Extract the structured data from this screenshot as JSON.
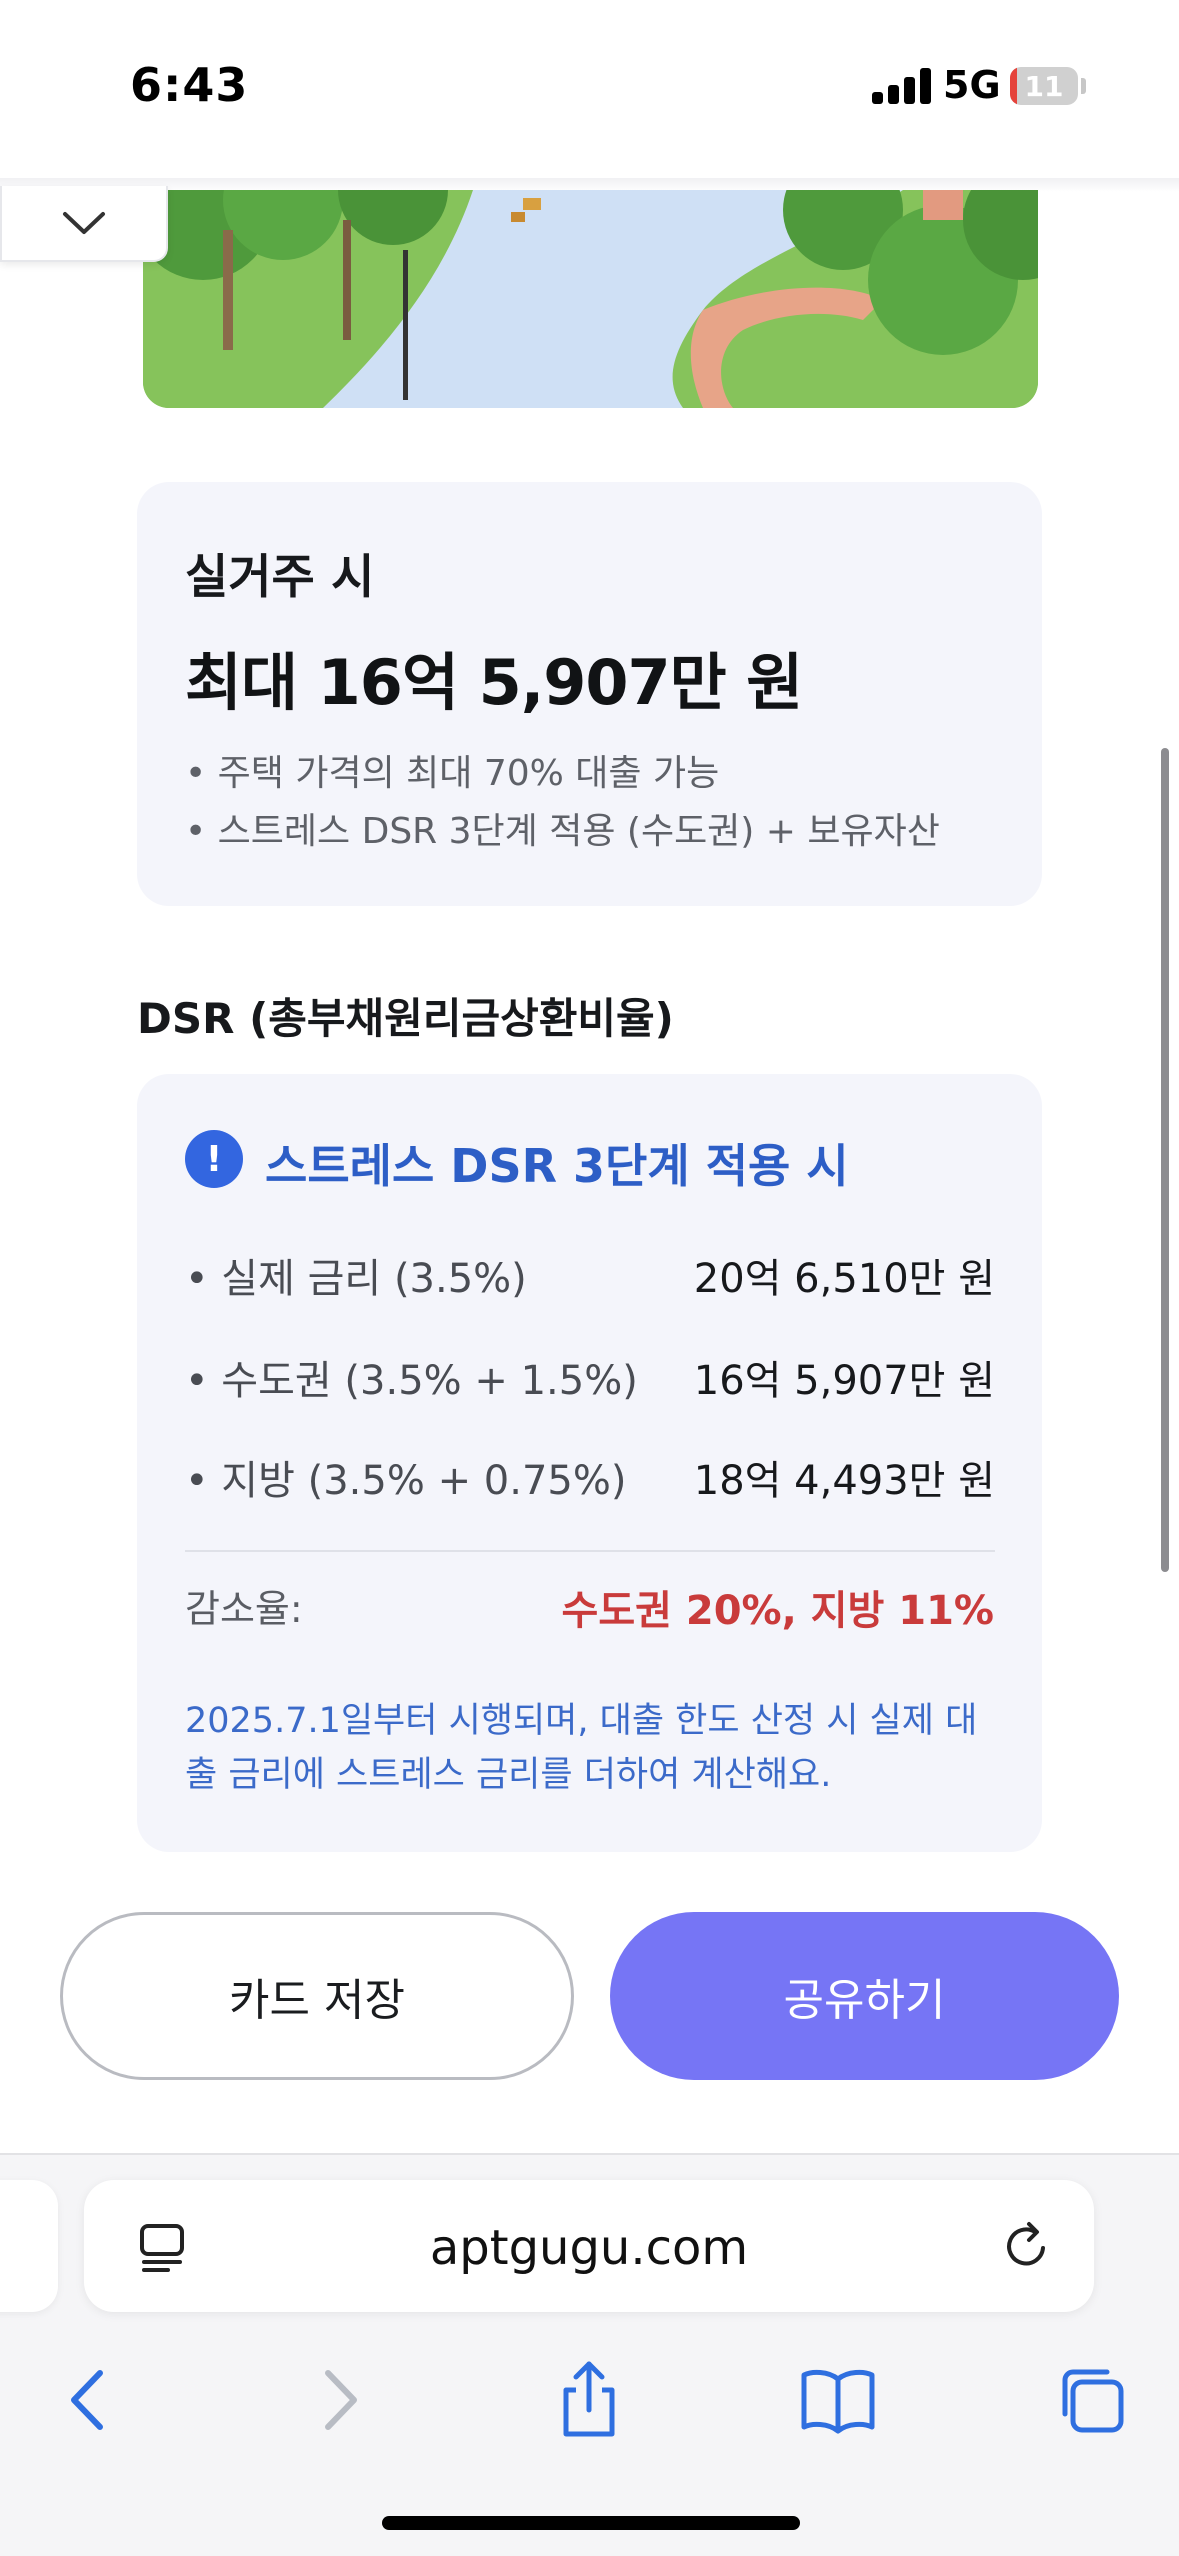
{
  "status_bar": {
    "time": "6:43",
    "network": "5G",
    "battery": "11",
    "battery_level": 0.11
  },
  "card_top": {
    "label": "실거주 시",
    "amount": "최대 16억 5,907만 원",
    "bullets": [
      "• 주택 가격의 최대 70% 대출 가능",
      "• 스트레스 DSR 3단계 적용 (수도권) + 보유자산"
    ]
  },
  "dsr": {
    "section_title": "DSR (총부채원리금상환비율)",
    "alert_icon": "!",
    "alert_title": "스트레스 DSR 3단계 적용 시",
    "rows": [
      {
        "label": "• 실제 금리 (3.5%)",
        "value": "20억 6,510만 원"
      },
      {
        "label": "• 수도권 (3.5% + 1.5%)",
        "value": "16억 5,907만 원"
      },
      {
        "label": "• 지방 (3.5% + 0.75%)",
        "value": "18억 4,493만 원"
      }
    ],
    "reduction_label": "감소율:",
    "reduction_value": "수도권 20%, 지방 11%",
    "note": "2025.7.1일부터 시행되며, 대출 한도 산정 시 실제 대출 금리에 스트레스 금리를 더하여 계산해요."
  },
  "buttons": {
    "save": "카드 저장",
    "share": "공유하기"
  },
  "browser": {
    "url": "aptgugu.com"
  },
  "colors": {
    "accent": "#7675F5",
    "alert_blue": "#2D5EC6",
    "reduction_red": "#C93B3B",
    "card_bg": "#F4F5FB"
  }
}
